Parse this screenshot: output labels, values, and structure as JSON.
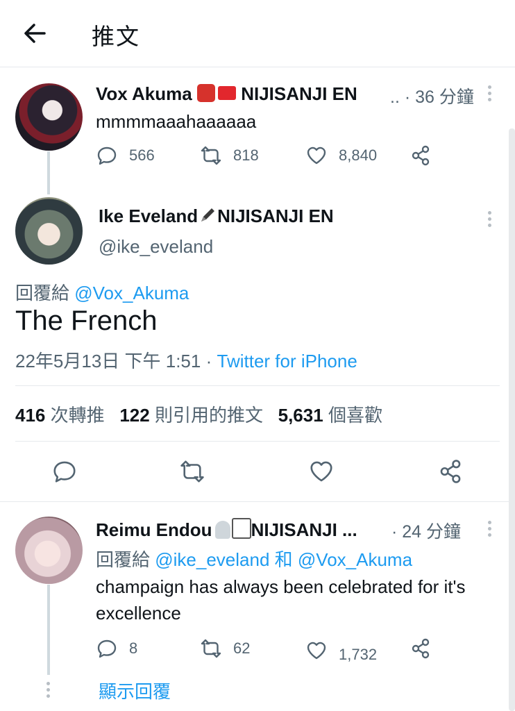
{
  "header": {
    "title": "推文"
  },
  "tweet1": {
    "display_name": "Vox Akuma",
    "name_suffix": "NIJISANJI EN",
    "ellipsis": "..",
    "time": "· 36 分鐘",
    "text": "mmmmaaahaaaaaa",
    "stats": {
      "replies": "566",
      "retweets": "818",
      "likes": "8,840"
    }
  },
  "main_tweet": {
    "display_name": "Ike Eveland",
    "name_suffix": "NIJISANJI EN",
    "handle": "@ike_eveland",
    "reply_label": "回覆給",
    "reply_to": "@Vox_Akuma",
    "text": "The French",
    "timestamp": "22年5月13日 下午 1:51",
    "separator": "·",
    "source": "Twitter for iPhone",
    "retweets_count": "416",
    "retweets_label": "次轉推",
    "quotes_count": "122",
    "quotes_label": "則引用的推文",
    "likes_count": "5,631",
    "likes_label": "個喜歡"
  },
  "tweet3": {
    "display_name": "Reimu Endou",
    "name_suffix": "NIJISANJI ...",
    "time": "· 24 分鐘",
    "reply_label": "回覆給",
    "reply_to_1": "@ike_eveland",
    "reply_and": "和",
    "reply_to_2": "@Vox_Akuma",
    "text": "champaign has always been celebrated for it's excellence",
    "stats": {
      "replies": "8",
      "retweets": "62",
      "likes": "1,732"
    },
    "show_replies": "顯示回覆"
  },
  "colors": {
    "link": "#1d9bf0",
    "secondary_text": "#536471",
    "divider": "#e6e9ec"
  }
}
